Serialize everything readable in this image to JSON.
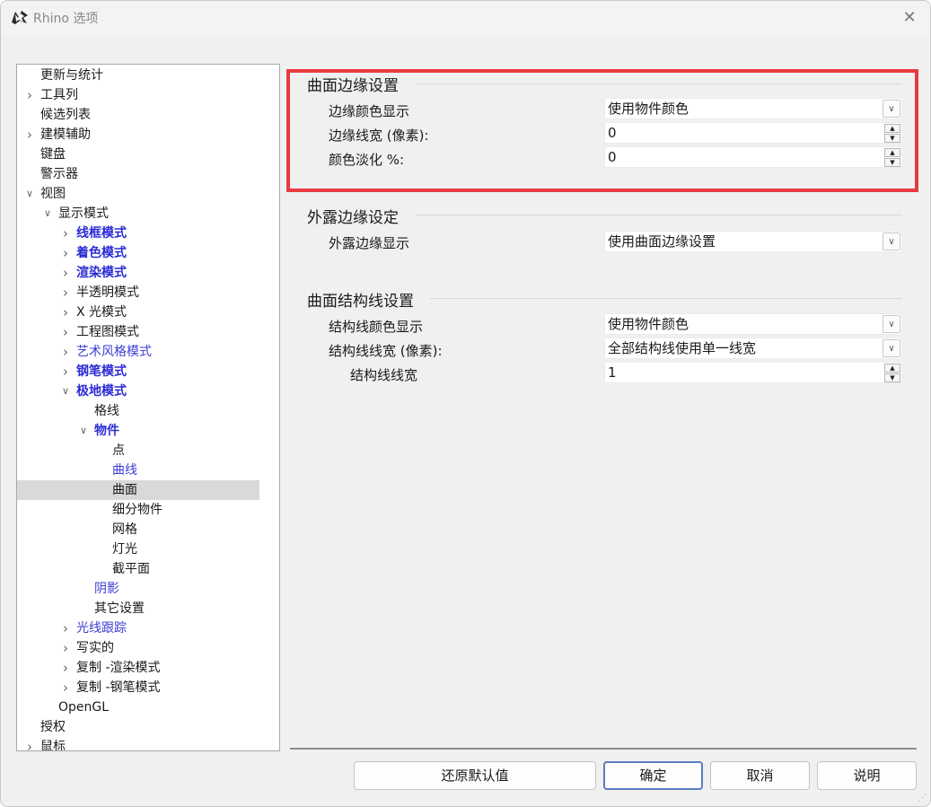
{
  "window": {
    "title": "Rhino 选项",
    "close_symbol": "✕"
  },
  "tree": {
    "items": [
      {
        "label": "更新与统计",
        "chevron": ""
      },
      {
        "label": "工具列",
        "chevron": "›"
      },
      {
        "label": "候选列表",
        "chevron": ""
      },
      {
        "label": "建模辅助",
        "chevron": "›"
      },
      {
        "label": "键盘",
        "chevron": ""
      },
      {
        "label": "警示器",
        "chevron": ""
      },
      {
        "label": "视图",
        "chevron": "⌄"
      },
      {
        "label": "显示模式",
        "chevron": "⌄"
      },
      {
        "label": "线框模式",
        "chevron": "›"
      },
      {
        "label": "着色模式",
        "chevron": "›"
      },
      {
        "label": "渲染模式",
        "chevron": "›"
      },
      {
        "label": "半透明模式",
        "chevron": "›"
      },
      {
        "label": "X 光模式",
        "chevron": "›"
      },
      {
        "label": "工程图模式",
        "chevron": "›"
      },
      {
        "label": "艺术风格模式",
        "chevron": "›"
      },
      {
        "label": "钢笔模式",
        "chevron": "›"
      },
      {
        "label": "极地模式",
        "chevron": "⌄"
      },
      {
        "label": "格线",
        "chevron": ""
      },
      {
        "label": "物件",
        "chevron": "⌄"
      },
      {
        "label": "点",
        "chevron": ""
      },
      {
        "label": "曲线",
        "chevron": ""
      },
      {
        "label": "曲面",
        "chevron": ""
      },
      {
        "label": "细分物件",
        "chevron": ""
      },
      {
        "label": "网格",
        "chevron": ""
      },
      {
        "label": "灯光",
        "chevron": ""
      },
      {
        "label": "截平面",
        "chevron": ""
      },
      {
        "label": "阴影",
        "chevron": ""
      },
      {
        "label": "其它设置",
        "chevron": ""
      },
      {
        "label": "光线跟踪",
        "chevron": "›"
      },
      {
        "label": "写实的",
        "chevron": "›"
      },
      {
        "label": "复制 -渲染模式",
        "chevron": "›"
      },
      {
        "label": "复制 -钢笔模式",
        "chevron": "›"
      },
      {
        "label": "OpenGL",
        "chevron": ""
      },
      {
        "label": "授权",
        "chevron": ""
      },
      {
        "label": "鼠标",
        "chevron": "›"
      }
    ],
    "selected": "曲面"
  },
  "sections": {
    "edge": {
      "title": "曲面边缘设置",
      "color_label": "边缘颜色显示",
      "color_value": "使用物件颜色",
      "width_label": "边缘线宽 (像素):",
      "width_value": "0",
      "fade_label": "颜色淡化 %:",
      "fade_value": "0"
    },
    "naked": {
      "title": "外露边缘设定",
      "display_label": "外露边缘显示",
      "display_value": "使用曲面边缘设置"
    },
    "iso": {
      "title": "曲面结构线设置",
      "color_label": "结构线颜色显示",
      "color_value": "使用物件颜色",
      "width_label": "结构线线宽 (像素):",
      "width_value": "全部结构线使用单一线宽",
      "single_label": "结构线线宽",
      "single_value": "1"
    }
  },
  "buttons": {
    "restore": "还原默认值",
    "ok": "确定",
    "cancel": "取消",
    "help": "说明"
  },
  "colors": {
    "highlight_border": "#e83a40",
    "bold_item": "#2b2bd6"
  }
}
